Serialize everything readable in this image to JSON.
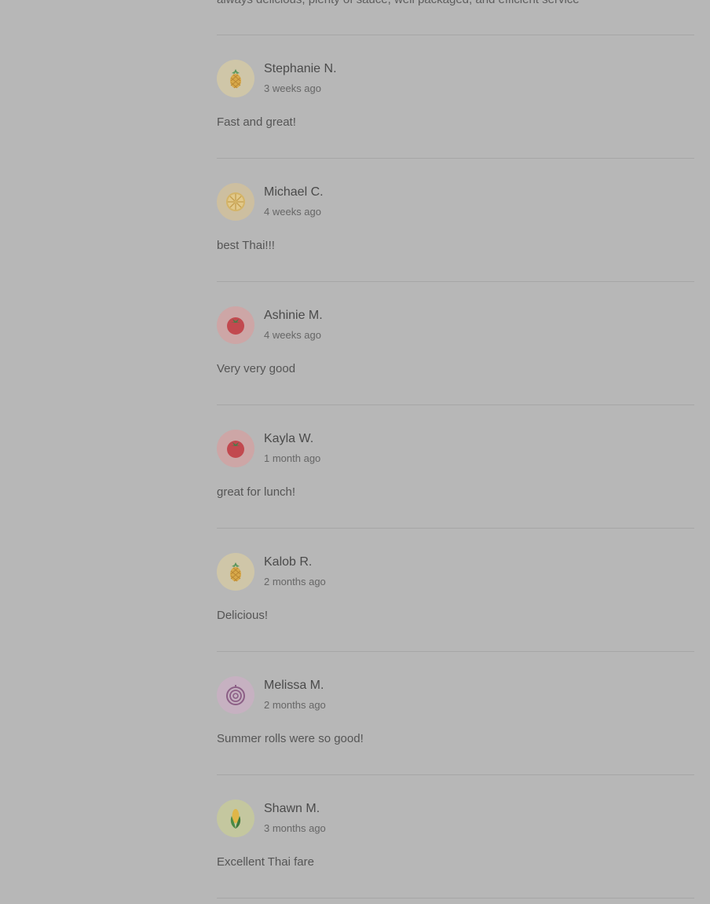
{
  "top_snippet": "always delicious, plenty of sauce, well packaged, and efficient service",
  "reviews": [
    {
      "name": "Stephanie N.",
      "time": "3 weeks ago",
      "text": "Fast and great!",
      "avatar": "pineapple-icon",
      "avatar_bg": "#cfc6a8"
    },
    {
      "name": "Michael C.",
      "time": "4 weeks ago",
      "text": "best Thai!!!",
      "avatar": "lemon-slice-icon",
      "avatar_bg": "#cdbfa0"
    },
    {
      "name": "Ashinie M.",
      "time": "4 weeks ago",
      "text": "Very very good",
      "avatar": "tomato-icon",
      "avatar_bg": "#cda6a6"
    },
    {
      "name": "Kayla W.",
      "time": "1 month ago",
      "text": "great for lunch!",
      "avatar": "tomato-icon",
      "avatar_bg": "#cda6a6"
    },
    {
      "name": "Kalob R.",
      "time": "2 months ago",
      "text": "Delicious!",
      "avatar": "pineapple-icon",
      "avatar_bg": "#cfc6a8"
    },
    {
      "name": "Melissa M.",
      "time": "2 months ago",
      "text": "Summer rolls were so good!",
      "avatar": "onion-icon",
      "avatar_bg": "#c6b1c1"
    },
    {
      "name": "Shawn M.",
      "time": "3 months ago",
      "text": "Excellent Thai fare",
      "avatar": "corn-icon",
      "avatar_bg": "#c4c79f"
    }
  ]
}
